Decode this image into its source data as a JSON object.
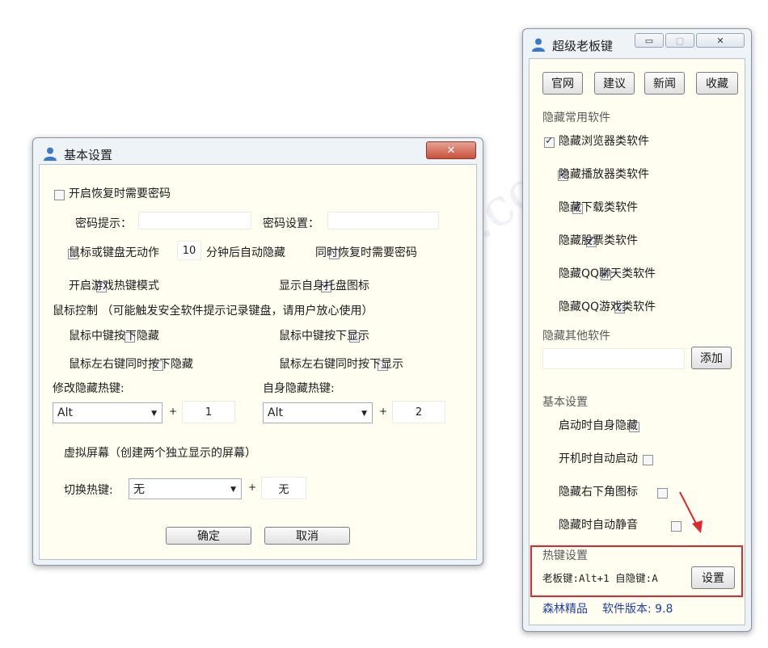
{
  "basic_dialog": {
    "title": "基本设置",
    "close_glyph": "✕",
    "require_password": "开启恢复时需要密码",
    "password_hint_label": "密码提示：",
    "password_set_label": "密码设置：",
    "idle_prefix": "鼠标或键盘无动作",
    "idle_minutes": "10",
    "idle_suffix": "分钟后自动隐藏",
    "restore_password": "同时恢复时需要密码",
    "game_mode": "开启游戏热键模式",
    "show_tray_icon": "显示自身托盘图标",
    "mouse_control": "鼠标控制 （可能触发安全软件提示记录键盘，请用户放心使用）",
    "middle_hide": "鼠标中键按下隐藏",
    "middle_show": "鼠标中键按下显示",
    "lr_hide": "鼠标左右键同时按下隐藏",
    "lr_show": "鼠标左右键同时按下显示",
    "hide_hotkey_label": "修改隐藏热键:",
    "self_hotkey_label": "自身隐藏热键:",
    "hide_modifier": "Alt",
    "hide_key": "1",
    "self_modifier": "Alt",
    "self_key": "2",
    "plus": "+",
    "virtual_screen": "虚拟屏幕（创建两个独立显示的屏幕）",
    "switch_hotkey_label": "切换热键:",
    "switch_modifier": "无",
    "switch_key": "无",
    "ok": "确定",
    "cancel": "取消"
  },
  "boss_key": {
    "title": "超级老板键",
    "min_glyph": "▭",
    "max_glyph": "▢",
    "close_glyph": "✕",
    "buttons": [
      "官网",
      "建议",
      "新闻",
      "收藏"
    ],
    "common_section": "隐藏常用软件",
    "common_items": [
      "隐藏浏览器类软件",
      "隐藏播放器类软件",
      "隐藏下载类软件",
      "隐藏股票类软件",
      "隐藏QQ聊天类软件",
      "隐藏QQ游戏类软件"
    ],
    "other_section": "隐藏其他软件",
    "add": "添加",
    "basic_section": "基本设置",
    "basic_items": [
      "启动时自身隐藏",
      "开机时自动启动",
      "隐藏右下角图标",
      "隐藏时自动静音"
    ],
    "hotkey_section": "热键设置",
    "hotkey_summary": "老板键:Alt+1 自隐键:A",
    "settings": "设置",
    "footer_brand": "森林精品",
    "footer_version": "软件版本: 9.8"
  },
  "colors": {
    "highlight_box": "#e0262e",
    "arrow": "#e0262e",
    "footer_text": "#1f3fa6",
    "section_text": "#5a5a5a"
  }
}
